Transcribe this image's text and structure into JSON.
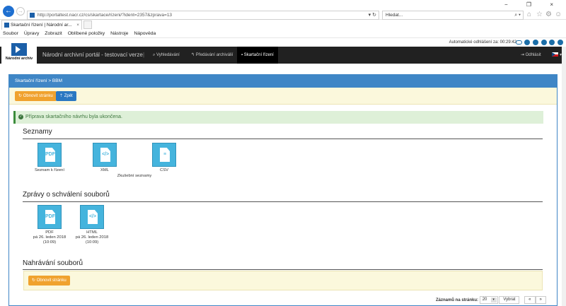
{
  "browser": {
    "url": "http://portaltest.nacr.cz/cs/skartace/rizeni/?ident=2357&zprava=13",
    "search_placeholder": "Hledat...",
    "tab_title": "Skartační řízení | Národní ar...",
    "tab_close": "×",
    "back_glyph": "←",
    "forward_glyph": "→",
    "url_icons": "▾ ↻",
    "search_icons": "⌕ ▾",
    "window_controls": "− ❐ ×",
    "menu": [
      "Soubor",
      "Úpravy",
      "Zobrazit",
      "Oblíbené položky",
      "Nástroje",
      "Nápověda"
    ],
    "tool_icons": [
      "⌂",
      "☆",
      "⚙",
      "☺"
    ]
  },
  "site": {
    "logout_timer": "Automatické odhlášení za: 00:29:42",
    "logo_text": "Národní archiv",
    "app_title": "Národní archivní portál - testovací verze",
    "separator": "|",
    "nav": [
      {
        "label": "Vyhledávání",
        "icon": "search-icon"
      },
      {
        "label": "Předávání archiválií",
        "icon": "reply-icon"
      },
      {
        "label": "Skartační řízení",
        "icon": "trash-icon"
      }
    ],
    "logout": "Odhlásit"
  },
  "panel": {
    "breadcrumb": "Skartační řízení > BBM",
    "refresh_button": "Obnovit stránku",
    "back_button": "Zpět",
    "alert": "Příprava skartačního návrhu byla ukončena.",
    "alert_check": "✓"
  },
  "lists": {
    "title": "Seznamy",
    "files": [
      {
        "label": "Seznam k řízení",
        "icon": "pdf-icon",
        "glyph": "PDF"
      },
      {
        "label": "XML",
        "icon": "xml-icon",
        "glyph": "</>"
      },
      {
        "label": "CSV",
        "icon": "csv-icon",
        "glyph": "≡"
      }
    ],
    "sub_label": "Zkušební seznamy"
  },
  "approvals": {
    "title": "Zprávy o schválení souborů",
    "files": [
      {
        "label": "PDF",
        "date": "pá 26. leden 2018",
        "time": "(10:09)",
        "icon": "pdf-icon",
        "glyph": "PDF"
      },
      {
        "label": "HTML",
        "date": "pá 26. leden 2018",
        "time": "(10:09)",
        "icon": "html-icon",
        "glyph": "</>"
      }
    ]
  },
  "uploads": {
    "title": "Nahrávání souborů",
    "refresh_button": "Obnovit stránku"
  },
  "pager": {
    "label": "Záznamů na stránku:",
    "value": "20",
    "select_button": "Vybrat",
    "prev": "«",
    "next": "»"
  },
  "colors": {
    "primary": "#3f86c6",
    "orange": "#f0a22e",
    "success_bg": "#def0d8",
    "icon_bg": "#45b4dd"
  }
}
